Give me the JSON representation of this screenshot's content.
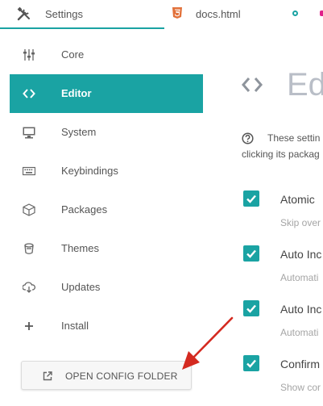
{
  "tabs": [
    {
      "label": "Settings",
      "icon": "tools-icon"
    },
    {
      "label": "docs.html",
      "icon": "html5-icon"
    }
  ],
  "sidebar": {
    "items": [
      {
        "label": "Core",
        "icon": "sliders-icon"
      },
      {
        "label": "Editor",
        "icon": "code-icon",
        "active": true
      },
      {
        "label": "System",
        "icon": "monitor-icon"
      },
      {
        "label": "Keybindings",
        "icon": "keyboard-icon"
      },
      {
        "label": "Packages",
        "icon": "package-icon"
      },
      {
        "label": "Themes",
        "icon": "paint-bucket-icon"
      },
      {
        "label": "Updates",
        "icon": "cloud-download-icon"
      },
      {
        "label": "Install",
        "icon": "plus-icon"
      }
    ],
    "open_config_label": "OPEN CONFIG FOLDER"
  },
  "main": {
    "title": "Ed",
    "description_line1": "These settin",
    "description_line2": "clicking its packag",
    "settings": [
      {
        "title": "Atomic",
        "description": "Skip over",
        "checked": true
      },
      {
        "title": "Auto Inc",
        "description": "Automati",
        "checked": true
      },
      {
        "title": "Auto Inc",
        "description": "Automati",
        "checked": true
      },
      {
        "title": "Confirm",
        "description": "Show cor",
        "checked": true
      }
    ]
  },
  "colors": {
    "accent": "#1aa3a3",
    "annotation_arrow": "#d42a20",
    "title_gray": "#b9bec7"
  }
}
